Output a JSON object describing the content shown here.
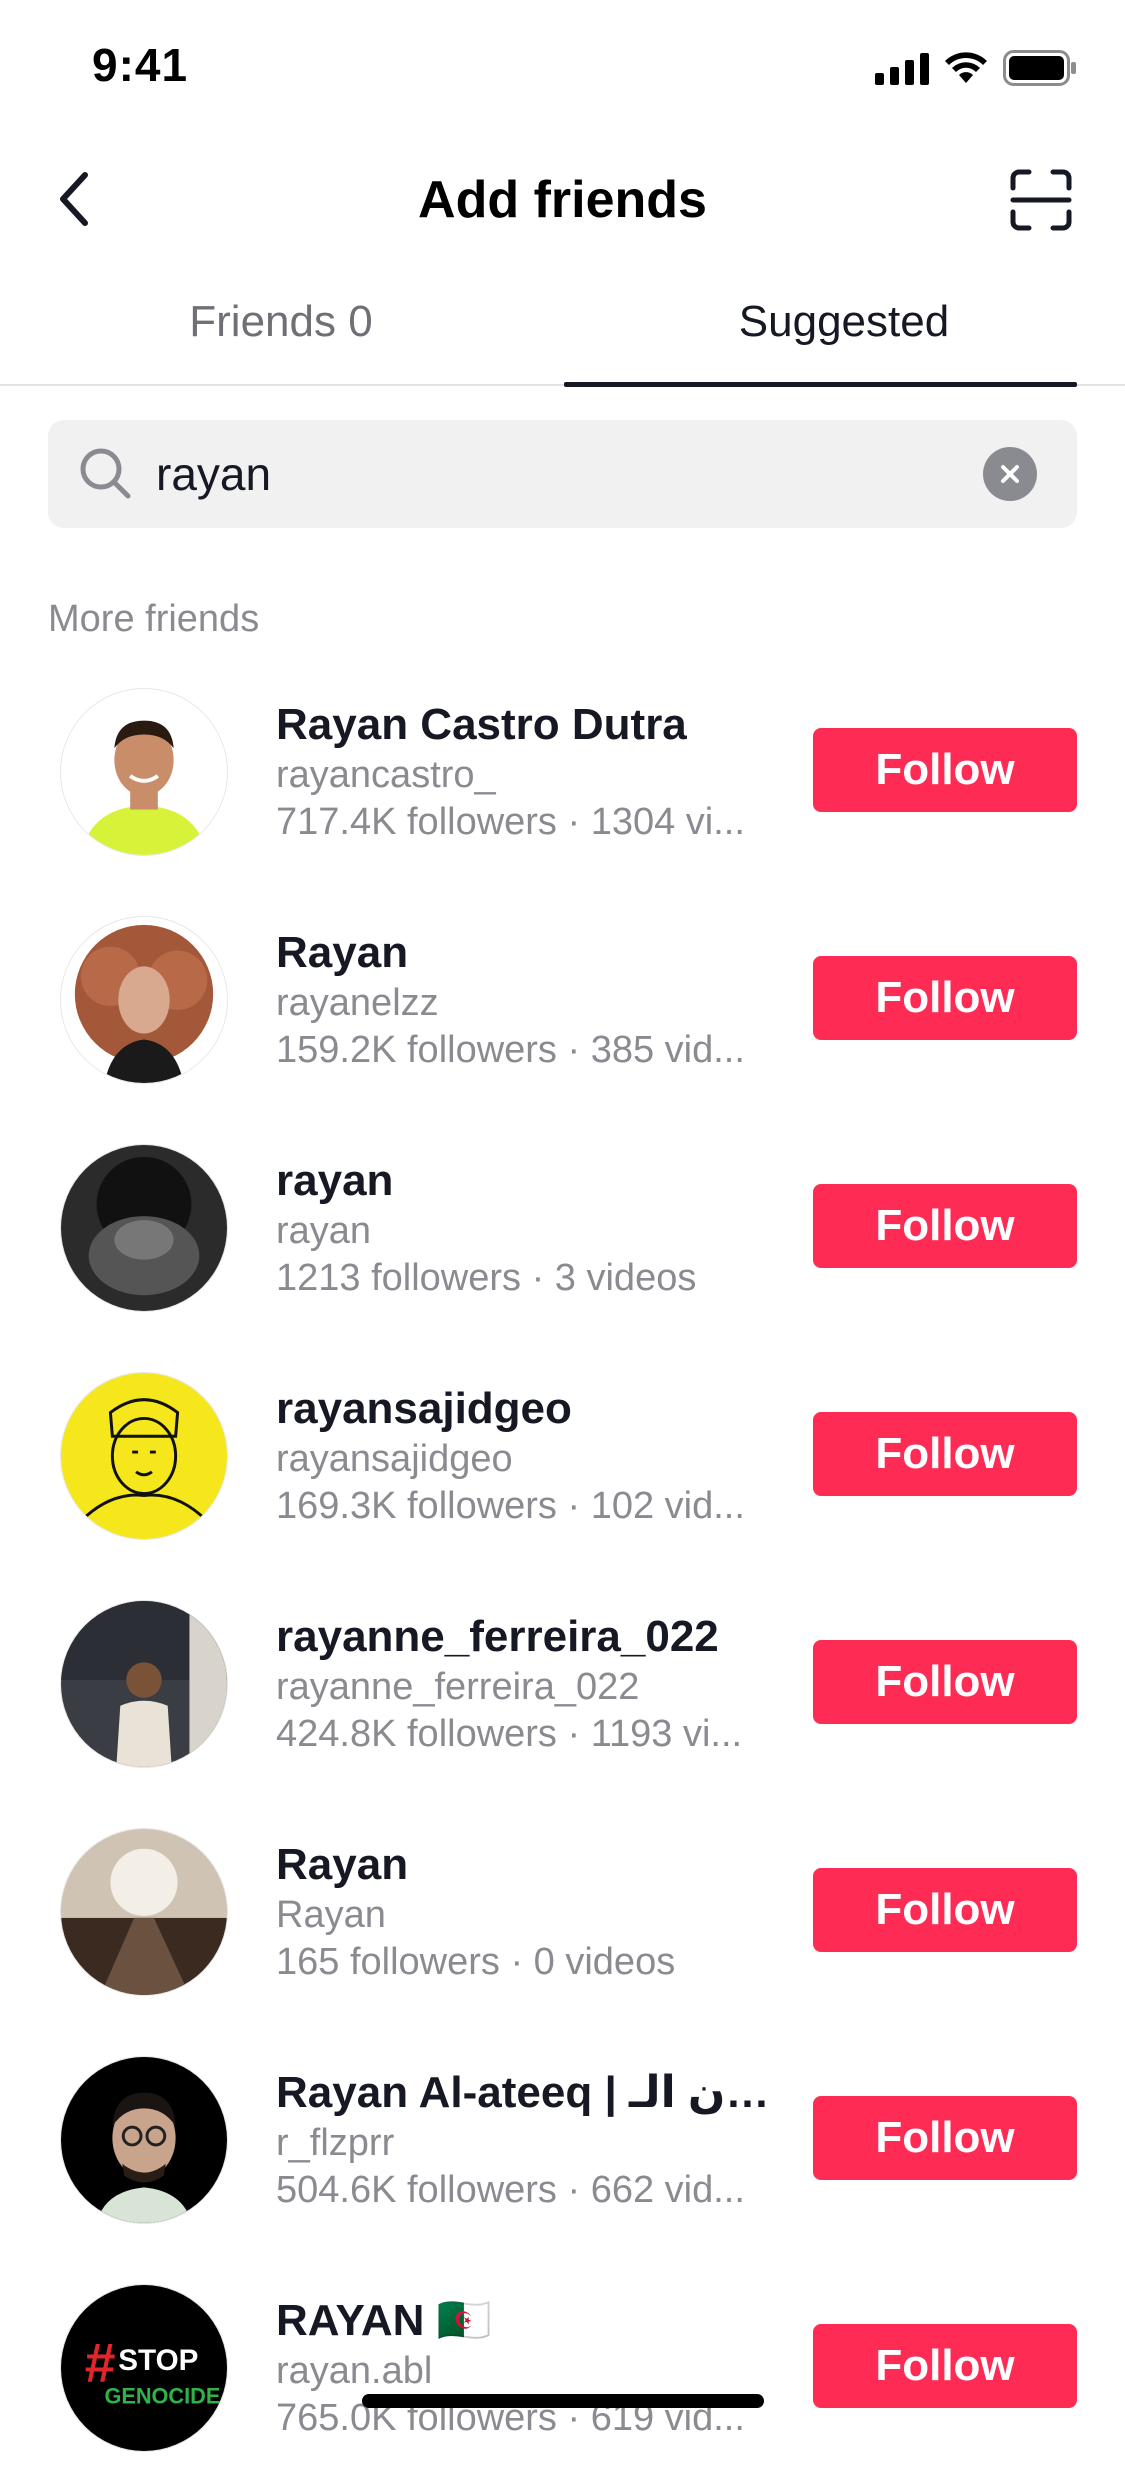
{
  "status_bar": {
    "time": "9:41"
  },
  "header": {
    "title": "Add friends",
    "back_icon": "chevron-left-icon",
    "scan_icon": "scan-icon"
  },
  "tabs": [
    {
      "label": "Friends 0",
      "active": false
    },
    {
      "label": "Suggested",
      "active": true
    }
  ],
  "search": {
    "value": "rayan",
    "placeholder": "Search"
  },
  "section_title": "More friends",
  "accent_color": "#fe2c55",
  "users": [
    {
      "name": "Rayan Castro Dutra",
      "handle": "rayancastro_",
      "stats": "717.4K followers · 1304 vi...",
      "button": "Follow"
    },
    {
      "name": "Rayan",
      "handle": "rayanelzz",
      "stats": "159.2K followers · 385 vid...",
      "button": "Follow"
    },
    {
      "name": "rayan",
      "handle": "rayan",
      "stats": "1213 followers · 3 videos",
      "button": "Follow"
    },
    {
      "name": "rayansajidgeo",
      "handle": "rayansajidgeo",
      "stats": "169.3K followers · 102 vid...",
      "button": "Follow"
    },
    {
      "name": "rayanne_ferreira_022",
      "handle": "rayanne_ferreira_022",
      "stats": "424.8K followers · 1193 vi...",
      "button": "Follow"
    },
    {
      "name": "Rayan",
      "handle": "Rayan",
      "stats": "165 followers · 0 videos",
      "button": "Follow"
    },
    {
      "name": "Rayan Al-ateeq | ريان الـ...",
      "handle": "r_flzprr",
      "stats": "504.6K followers · 662 vid...",
      "button": "Follow"
    },
    {
      "name": "RAYAN 🇩🇿",
      "handle": "rayan.abl",
      "stats": "765.0K followers · 619 vid...",
      "button": "Follow"
    }
  ]
}
